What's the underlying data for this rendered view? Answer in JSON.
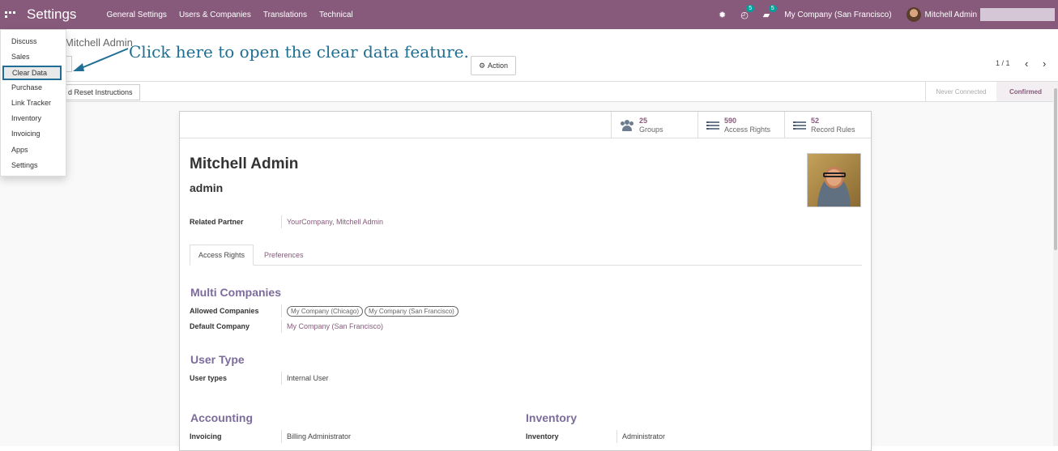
{
  "navbar": {
    "app_title": "Settings",
    "menus": [
      "General Settings",
      "Users & Companies",
      "Translations",
      "Technical"
    ],
    "activity_count": "5",
    "messages_count": "5",
    "company": "My Company (San Francisco)",
    "user": "Mitchell Admin"
  },
  "control_panel": {
    "breadcrumb": "Mitchell Admin",
    "action_label": "Action",
    "pager": "1 / 1",
    "reset_label": "Send Password Reset Instructions",
    "reset_visible": "d Reset Instructions",
    "stages": [
      "Never Connected",
      "Confirmed"
    ],
    "active_stage": "Confirmed"
  },
  "dropdown": {
    "items": [
      "Discuss",
      "Sales",
      "Clear Data",
      "Purchase",
      "Link Tracker",
      "Inventory",
      "Invoicing",
      "Apps",
      "Settings"
    ],
    "highlighted": "Clear Data"
  },
  "callout": "Click here to open the clear data feature.",
  "smart_buttons": [
    {
      "value": "25",
      "label": "Groups",
      "icon": "users-icon"
    },
    {
      "value": "590",
      "label": "Access Rights",
      "icon": "list-icon"
    },
    {
      "value": "52",
      "label": "Record Rules",
      "icon": "list-icon"
    }
  ],
  "form": {
    "name": "Mitchell Admin",
    "login": "admin",
    "related_partner_label": "Related Partner",
    "related_partner": "YourCompany, Mitchell Admin",
    "tabs": [
      "Access Rights",
      "Preferences"
    ],
    "multi_companies": {
      "title": "Multi Companies",
      "allowed_label": "Allowed Companies",
      "allowed": [
        "My Company (Chicago)",
        "My Company (San Francisco)"
      ],
      "default_label": "Default Company",
      "default": "My Company (San Francisco)"
    },
    "user_type": {
      "title": "User Type",
      "label": "User types",
      "value": "Internal User"
    },
    "accounting": {
      "title": "Accounting",
      "label": "Invoicing",
      "value": "Billing Administrator"
    },
    "inventory": {
      "title": "Inventory",
      "label": "Inventory",
      "value": "Administrator"
    }
  },
  "colors": {
    "brand": "#875a7b",
    "section": "#7c6c9b",
    "callout": "#1f6e93",
    "badge": "#00a09d"
  }
}
